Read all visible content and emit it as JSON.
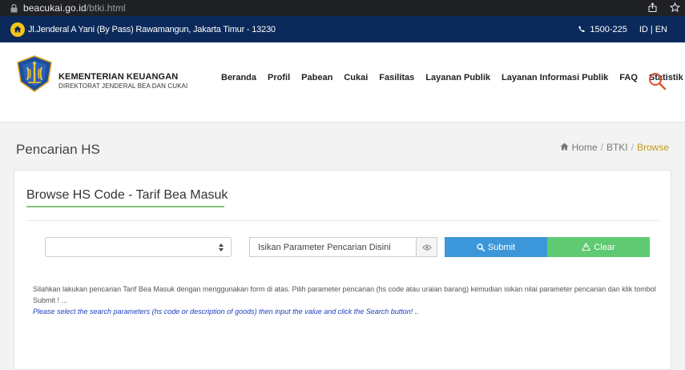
{
  "browser": {
    "url_host": "beacukai.go.id",
    "url_path": "/btki.html"
  },
  "topbar": {
    "address": "Jl.Jenderal A Yani (By Pass) Rawamangun, Jakarta Timur - 13230",
    "phone": "1500-225",
    "lang_id": "ID",
    "lang_sep": "|",
    "lang_en": "EN",
    "accent_color": "#f5c518",
    "bg_color": "#0b2a5b"
  },
  "header": {
    "brand_line1": "KEMENTERIAN KEUANGAN",
    "brand_line2": "DIREKTORAT JENDERAL BEA DAN CUKAI",
    "nav": [
      "Beranda",
      "Profil",
      "Pabean",
      "Cukai",
      "Fasilitas",
      "Layanan Publik",
      "Layanan Informasi Publik",
      "FAQ",
      "Statistik"
    ]
  },
  "page": {
    "title": "Pencarian HS",
    "breadcrumb": {
      "home": "Home",
      "btki": "BTKI",
      "current": "Browse",
      "sep": "/"
    }
  },
  "card": {
    "heading": "Browse HS Code - Tarif Bea Masuk",
    "select_value": "",
    "search_placeholder": "Isikan Parameter Pencarian Disini",
    "submit_label": "Submit",
    "clear_label": "Clear",
    "info_id": "Silahkan lakukan pencarian Tarif Bea Masuk dengan menggunakan form di atas. Pilih parameter pencarian (hs code atau uraian barang) kemudian isikan nilai parameter pencarian dan klik tombol Submit ! ...",
    "info_en": "Please select the search parameters (hs code or description of goods) then input the value and click the Search button! .."
  }
}
